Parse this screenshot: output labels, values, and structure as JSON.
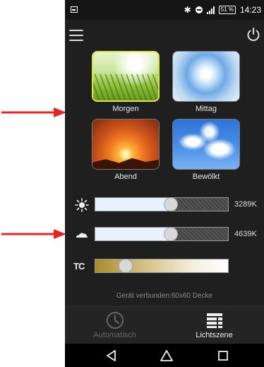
{
  "statusbar": {
    "time": "14:23",
    "battery": "51 %"
  },
  "scenes": [
    {
      "label": "Morgen",
      "selected": true
    },
    {
      "label": "Mittag",
      "selected": false
    },
    {
      "label": "Abend",
      "selected": false
    },
    {
      "label": "Bewölkt",
      "selected": false
    }
  ],
  "sliders": [
    {
      "icon": "sun-icon",
      "value_label": "3289K",
      "level": 0.57
    },
    {
      "icon": "cloud-icon",
      "value_label": "4639K",
      "level": 0.57
    },
    {
      "icon": "tc-icon",
      "label": "TC",
      "level": 0.23
    }
  ],
  "status_text": "Gerät verbunden:60x60 Decke",
  "tabs": [
    {
      "label": "Automatisch",
      "active": false
    },
    {
      "label": "Lichtszene",
      "active": true
    }
  ],
  "colors": {
    "accent_selected": "#e0e44a",
    "annotation_arrow": "#e32526",
    "background": "#1f1f1f"
  }
}
